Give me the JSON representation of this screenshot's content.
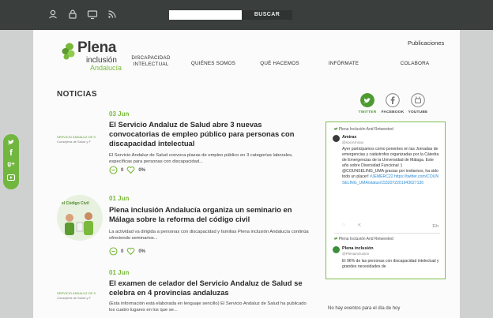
{
  "topbar": {
    "search": {
      "value": "",
      "button_label": "BUSCAR"
    },
    "contact_line": ""
  },
  "logo": {
    "plena": "Plena",
    "inclusion": "inclusión",
    "region": "Andalucía"
  },
  "header": {
    "publicaciones": "Publicaciones"
  },
  "nav": {
    "discapacidad_line1": "DISCAPACIDAD",
    "discapacidad_line2": "INTELECTUAL",
    "quienes": "QUIÉNES SOMOS",
    "que_hacemos": "QUÉ HACEMOS",
    "informate": "INFÓRMATE",
    "colabora": "COLABORA"
  },
  "section": {
    "title": "NOTICIAS"
  },
  "news": [
    {
      "date": "03 Jun",
      "title": "El Servicio Andaluz de Salud abre 3 nuevas convocatorias de empleo público para personas con discapacidad intelectual",
      "excerpt": "El Servicio Andaluz de Salud  convoca plazas de empleo público en 3 categorías laborales, específicas para personas con discapacidad...",
      "comments": "0",
      "likes": "0%",
      "thumb_line1": "SERVICIO ANDALUZ DE S",
      "thumb_line2": "Consejería de Salud y F"
    },
    {
      "date": "01 Jun",
      "title": "Plena inclusión Andalucía organiza un seminario en Málaga sobre la reforma del código civil",
      "excerpt": "La actividad va dirigida a personas con discapacidad y familias Plena inclusión Andalucía continúa ofreciendo seminarios...",
      "comments": "0",
      "likes": "0%",
      "thumb_line1": "el Código Civil"
    },
    {
      "date": "01 Jun",
      "title": "El examen de celador del Servicio Andaluz de Salud se celebra en 4 provincias andaluzas",
      "excerpt": "(Esta información está elaborada en lenguaje sencillo) El Servicio Andaluz de Salud ha publicado los cuatro lugares en los que se...",
      "thumb_line1": "SERVICIO ANDALUZ DE S",
      "thumb_line2": "Consejería de Salud y F"
    }
  ],
  "social": {
    "twitter": "TWITTER",
    "facebook": "FACEBOOK",
    "youtube": "YOUTUBE"
  },
  "widget": {
    "retweet_line": "Plena Inclusión And Retweeted",
    "tweet1_name": "Amirax",
    "tweet1_handle": "@sociAmirax",
    "tweet1_text": "Ayer participamos como ponentes en las Jornadas de emergencias y catástrofes organizadas por la Cátedra de Emergencias de la Universidad de Málaga. Este año sobre Diversidad Funcional :) @COUNSELING_UMA gracias por invitarnos, ha sido todo un placer!",
    "tweet1_hashtag": "#JEMERC22",
    "tweet1_link": "https://twitter.com/COUNSELING_UMA/status/1532072201943627136",
    "tweet1_time": "11h",
    "retweet_line2": "Plena Inclusión And Retweeted",
    "tweet2_name": "Plena inclusión",
    "tweet2_handle": "@Plenainclusion",
    "tweet2_text": "El 96% de las personas con discapacidad intelectual y grandes necesidades de"
  },
  "events": {
    "note": "No hay eventos para el día de hoy"
  },
  "colors": {
    "accent": "#79b83a",
    "topbar": "#3a3f3e",
    "link": "#2a8ad4"
  }
}
